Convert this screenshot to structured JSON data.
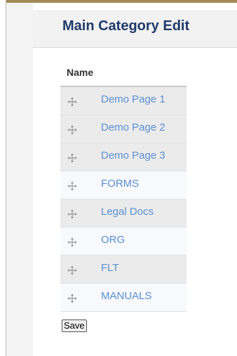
{
  "page": {
    "title": "Main Category Edit",
    "accent_color": "#a18a55",
    "title_color": "#1f3a6a",
    "link_color": "#5a8fd4"
  },
  "table": {
    "header": "Name",
    "rows": [
      {
        "label": "Demo Page 1",
        "icon": "drag-handle-icon"
      },
      {
        "label": "Demo Page 2",
        "icon": "drag-handle-icon"
      },
      {
        "label": "Demo Page 3",
        "icon": "drag-handle-icon"
      },
      {
        "label": "FORMS",
        "icon": "drag-handle-icon"
      },
      {
        "label": "Legal Docs",
        "icon": "drag-handle-icon"
      },
      {
        "label": "ORG",
        "icon": "drag-handle-icon"
      },
      {
        "label": "FLT",
        "icon": "drag-handle-icon"
      },
      {
        "label": "MANUALS",
        "icon": "drag-handle-icon"
      }
    ]
  },
  "actions": {
    "save_label": "Save"
  }
}
